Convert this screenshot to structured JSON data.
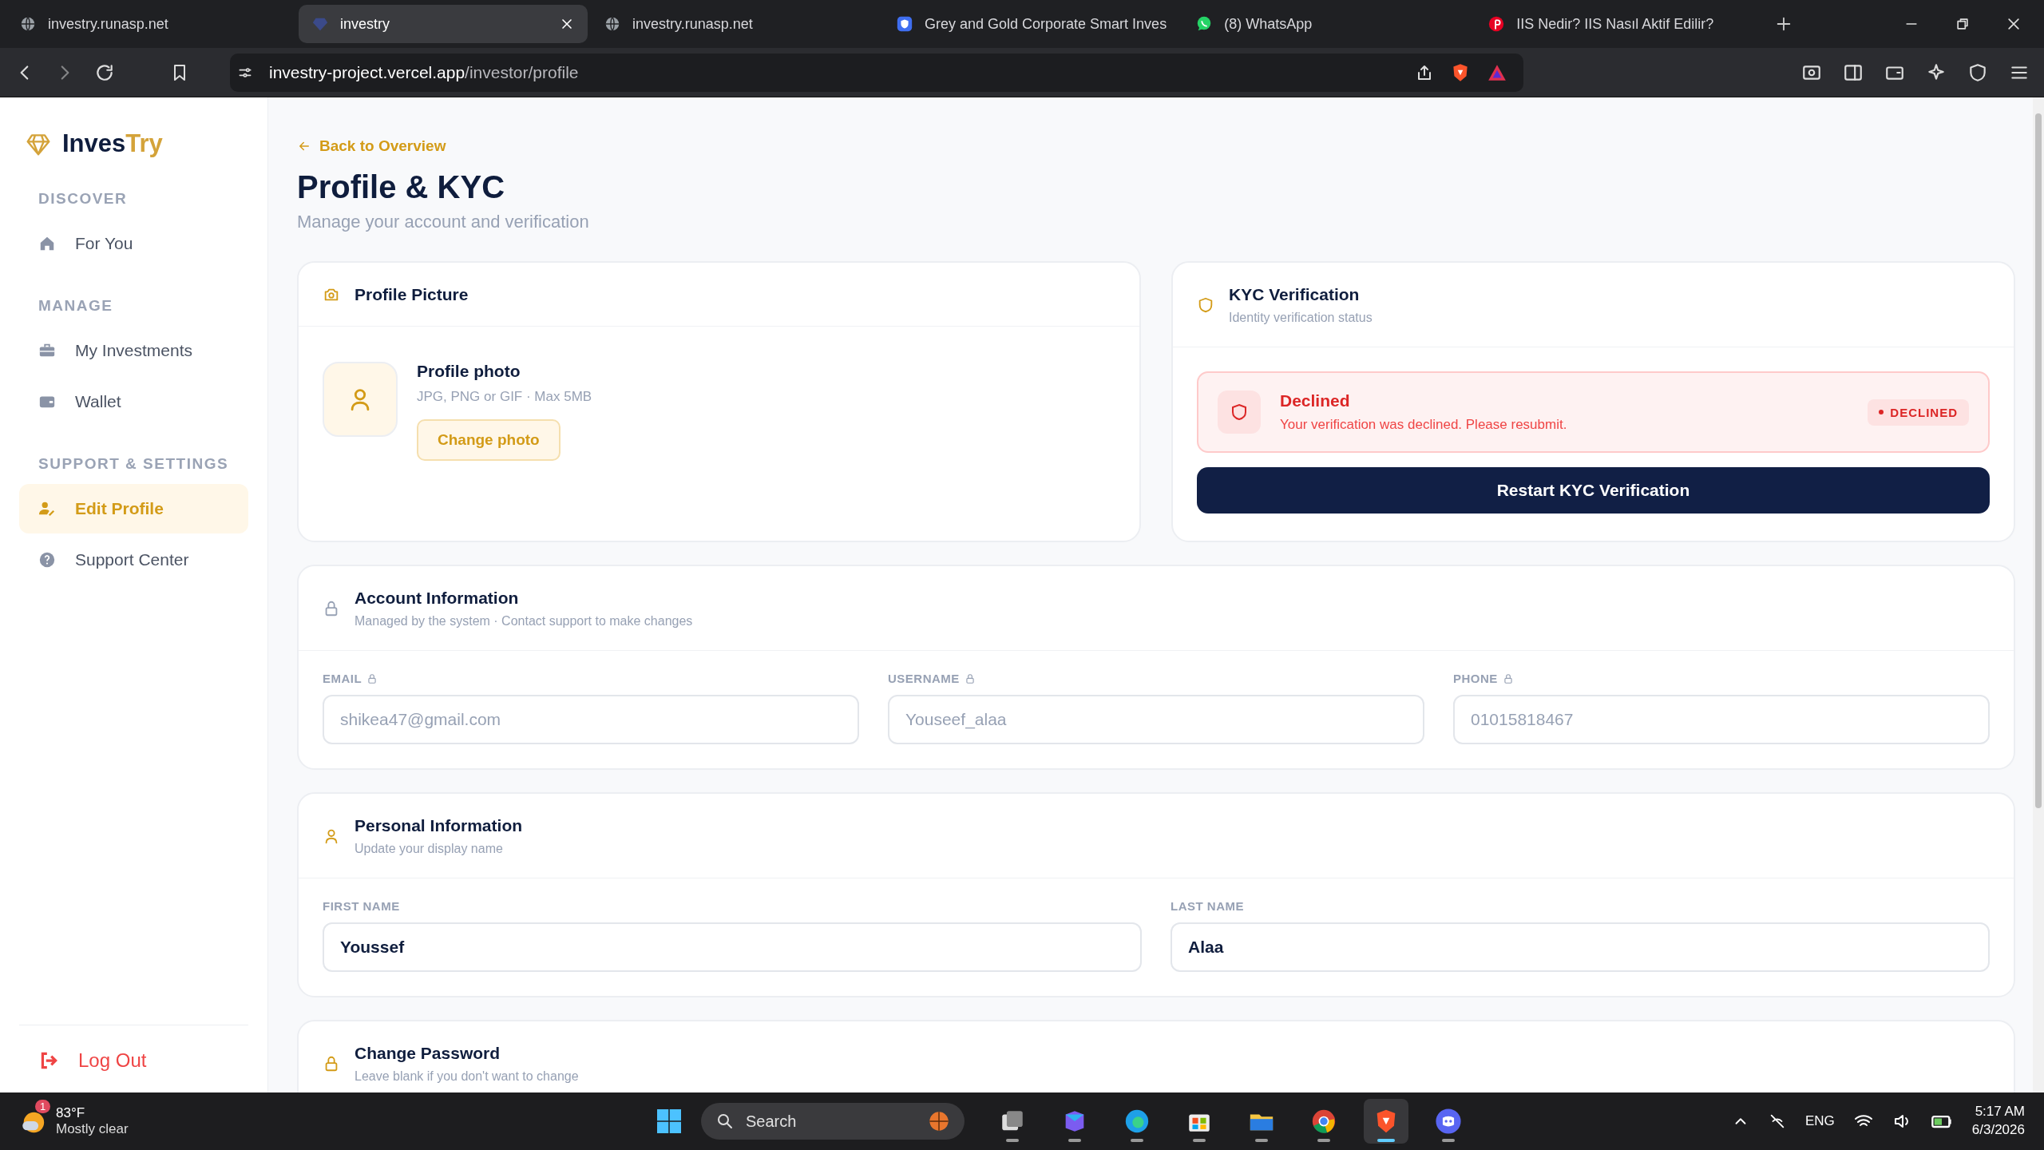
{
  "browser": {
    "tabs": [
      {
        "title": "investry.runasp.net",
        "selected": false
      },
      {
        "title": "investry",
        "selected": true
      },
      {
        "title": "investry.runasp.net",
        "selected": false
      },
      {
        "title": "Grey and Gold Corporate Smart Inves",
        "selected": false
      },
      {
        "title": "(8) WhatsApp",
        "selected": false
      },
      {
        "title": "IIS Nedir? IIS Nasıl Aktif Edilir?",
        "selected": false
      }
    ],
    "url_host": "investry-project.vercel.app",
    "url_path": "/investor/profile"
  },
  "sidebar": {
    "logo": {
      "first": "Inves",
      "second": "Try"
    },
    "sections": [
      {
        "heading": "DISCOVER",
        "items": [
          {
            "label": "For You",
            "selected": false
          }
        ]
      },
      {
        "heading": "MANAGE",
        "items": [
          {
            "label": "My Investments",
            "selected": false
          },
          {
            "label": "Wallet",
            "selected": false
          }
        ]
      },
      {
        "heading": "SUPPORT & SETTINGS",
        "items": [
          {
            "label": "Edit Profile",
            "selected": true
          },
          {
            "label": "Support Center",
            "selected": false
          }
        ]
      }
    ],
    "logout": "Log Out"
  },
  "page": {
    "back_link": "Back to Overview",
    "title": "Profile & KYC",
    "subtitle": "Manage your account and verification",
    "profile_picture": {
      "title": "Profile Picture",
      "photo_title": "Profile photo",
      "photo_hint": "JPG, PNG or GIF · Max 5MB",
      "button": "Change photo"
    },
    "kyc": {
      "title": "KYC Verification",
      "subtitle": "Identity verification status",
      "status": {
        "title": "Declined",
        "message": "Your verification was declined. Please resubmit.",
        "badge": "DECLINED"
      },
      "button": "Restart KYC Verification"
    },
    "account": {
      "title": "Account Information",
      "subtitle": "Managed by the system · Contact support to make changes",
      "fields": [
        {
          "label": "EMAIL",
          "value": "shikea47@gmail.com",
          "disabled": true
        },
        {
          "label": "USERNAME",
          "value": "Youseef_alaa",
          "disabled": true
        },
        {
          "label": "PHONE",
          "value": "01015818467",
          "disabled": true
        }
      ]
    },
    "personal": {
      "title": "Personal Information",
      "subtitle": "Update your display name",
      "fields": [
        {
          "label": "FIRST NAME",
          "value": "Youssef",
          "disabled": false
        },
        {
          "label": "LAST NAME",
          "value": "Alaa",
          "disabled": false
        }
      ]
    },
    "password": {
      "title": "Change Password",
      "subtitle": "Leave blank if you don't want to change"
    }
  },
  "taskbar": {
    "weather": {
      "temp": "83°F",
      "desc": "Mostly clear",
      "badge": "1"
    },
    "search": {
      "placeholder": "Search"
    },
    "apps": [
      {
        "kind": "taskview",
        "active": false
      },
      {
        "kind": "m365",
        "active": false
      },
      {
        "kind": "edge",
        "active": false
      },
      {
        "kind": "store",
        "active": false
      },
      {
        "kind": "folder",
        "active": false
      },
      {
        "kind": "chrome",
        "active": false
      },
      {
        "kind": "brave",
        "active": true
      },
      {
        "kind": "discord",
        "active": false
      }
    ],
    "lang": "ENG",
    "time": "5:17 AM",
    "date": "6/3/2026"
  }
}
